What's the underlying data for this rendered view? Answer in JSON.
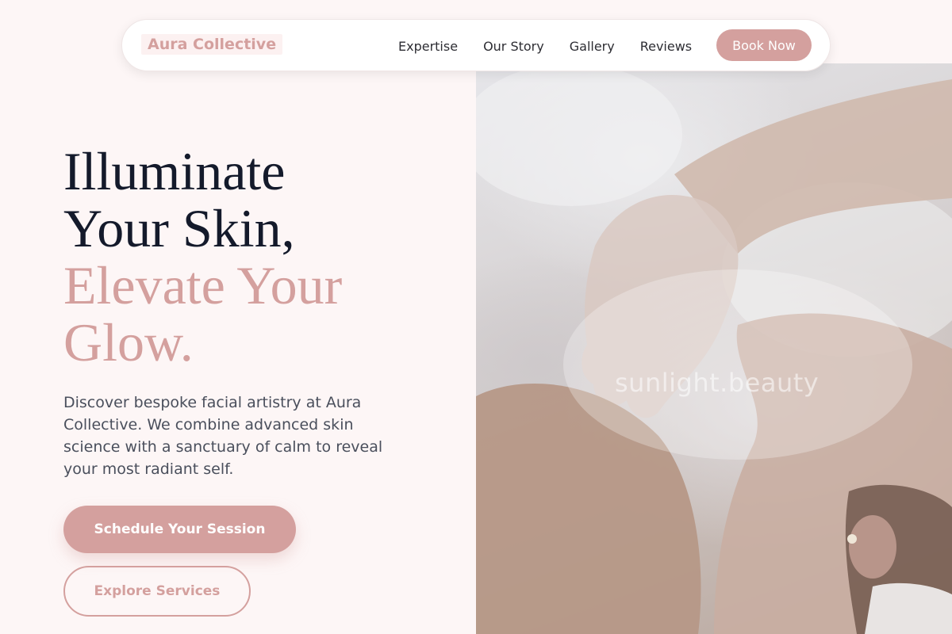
{
  "nav": {
    "logo": "Aura Collective",
    "links": [
      "Expertise",
      "Our Story",
      "Gallery",
      "Reviews"
    ],
    "cta": "Book Now"
  },
  "hero": {
    "headline_line1": "Illuminate",
    "headline_line2": "Your Skin,",
    "headline_accent_line1": "Elevate Your",
    "headline_accent_line2": "Glow.",
    "description": "Discover bespoke facial artistry at Aura Collective. We combine advanced skin science with a sanctuary of calm to reveal your most radiant self.",
    "primary_button": "Schedule Your Session",
    "secondary_button": "Explore Services",
    "image_watermark": "sunlight.beauty"
  },
  "colors": {
    "accent": "#d4a09e",
    "heading": "#141a2b",
    "background": "#fdf6f6",
    "body_text": "#4a4f5c"
  }
}
